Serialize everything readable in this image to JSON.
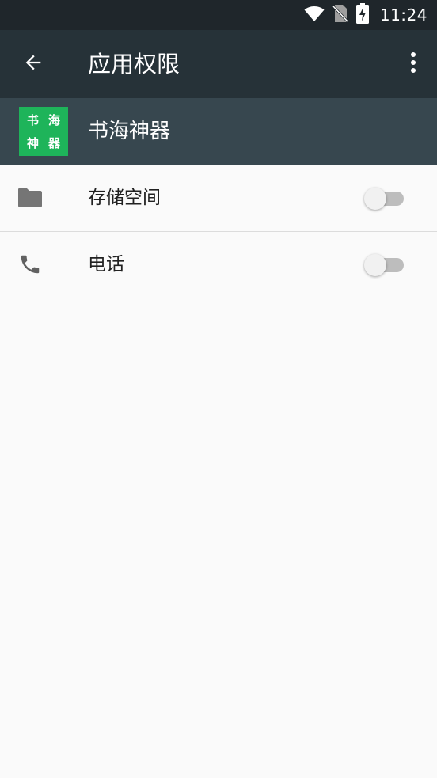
{
  "status_bar": {
    "time": "11:24",
    "icons": [
      "wifi-icon",
      "no-sim-icon",
      "battery-charging-icon"
    ]
  },
  "toolbar": {
    "back_icon": "arrow-back-icon",
    "title": "应用权限",
    "overflow_icon": "more-vert-icon"
  },
  "app": {
    "icon_chars": [
      "书",
      "海",
      "神",
      "器"
    ],
    "name": "书海神器",
    "icon_color": "#1eb45a"
  },
  "permissions": [
    {
      "icon": "folder-icon",
      "label": "存储空间",
      "enabled": false
    },
    {
      "icon": "phone-icon",
      "label": "电话",
      "enabled": false
    }
  ],
  "colors": {
    "status_bar": "#1f262b",
    "toolbar": "#263238",
    "app_header": "#37474f",
    "background": "#fafafa"
  }
}
